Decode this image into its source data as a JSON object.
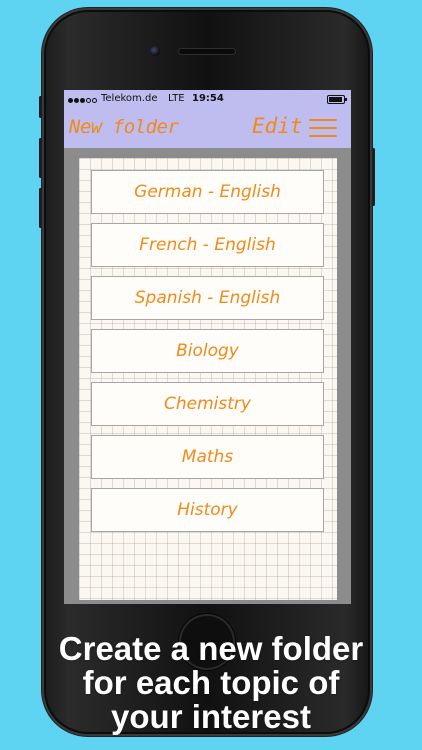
{
  "status_bar": {
    "carrier": "Telekom.de",
    "network": "LTE",
    "time": "19:54",
    "battery_level": 0.9
  },
  "nav": {
    "title": "New folder",
    "edit_label": "Edit",
    "menu_icon": "hamburger-menu-icon",
    "accent_color": "#f08a1a",
    "bar_color": "#bfbcf0"
  },
  "folders": [
    {
      "label": "German - English"
    },
    {
      "label": "French - English"
    },
    {
      "label": "Spanish - English"
    },
    {
      "label": "Biology"
    },
    {
      "label": "Chemistry"
    },
    {
      "label": "Maths"
    },
    {
      "label": "History"
    }
  ],
  "caption": {
    "line1": "Create a new folder",
    "line2": "for each topic of",
    "line3": "your interest"
  }
}
